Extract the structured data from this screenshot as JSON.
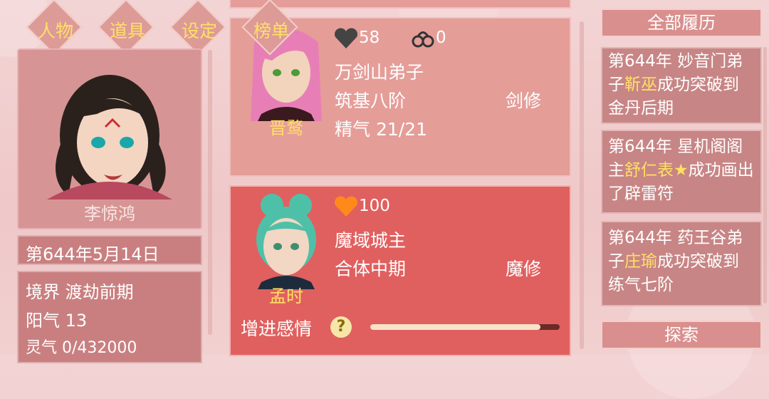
{
  "tabs": [
    {
      "label": "人物"
    },
    {
      "label": "道具"
    },
    {
      "label": "设定"
    },
    {
      "label": "榜单"
    }
  ],
  "player": {
    "name": "李惊鸿",
    "date": "第644年5月14日",
    "stats": [
      {
        "label": "境界",
        "value": "渡劫前期"
      },
      {
        "label": "阳气",
        "value": "13"
      },
      {
        "label": "灵气",
        "value": "0/432000"
      }
    ]
  },
  "characters": [
    {
      "name": "晋鹜",
      "affection": "58",
      "bonds": "0",
      "title": "万剑山弟子",
      "realm": "筑基八阶",
      "path": "剑修",
      "vitality": "精气 21/21",
      "heart_color": "#444444",
      "hair_color": "#e77fb6"
    },
    {
      "name": "孟时",
      "affection": "100",
      "title": "魔域城主",
      "realm": "合体中期",
      "path": "魔修",
      "heart_color": "#ff8a1a",
      "hair_color": "#4fc0a8",
      "action_label": "增进感情",
      "help_symbol": "?",
      "progress": 0.9
    }
  ],
  "history": {
    "header": "全部履历",
    "entries": [
      {
        "before": "第644年 妙音门弟子",
        "name": "靳巫",
        "after": "成功突破到金丹后期"
      },
      {
        "before": "第644年 星机阁阁主",
        "name": "舒仁表★",
        "after": "成功画出了辟雷符"
      },
      {
        "before": "第644年 药王谷弟子",
        "name": "庄瑜",
        "after": "成功突破到练气七阶"
      }
    ],
    "explore_label": "探索"
  },
  "colors": {
    "highlight": "#ffe066",
    "panel": "#d58d8d"
  }
}
